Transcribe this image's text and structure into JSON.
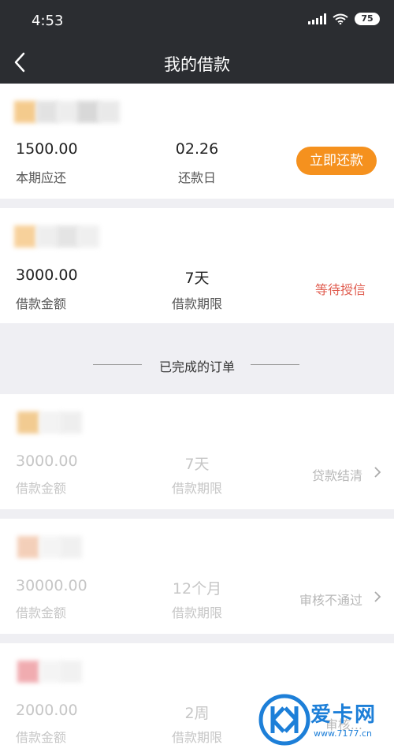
{
  "status_bar": {
    "time": "4:53",
    "battery": "75"
  },
  "nav": {
    "title": "我的借款"
  },
  "active_loans": [
    {
      "amount": "1500.00",
      "amount_label": "本期应还",
      "mid_value": "02.26",
      "mid_label": "还款日",
      "action": "立即还款"
    },
    {
      "amount": "3000.00",
      "amount_label": "借款金额",
      "mid_value": "7天",
      "mid_label": "借款期限",
      "status": "等待授信"
    }
  ],
  "completed_section_title": "已完成的订单",
  "completed_loans": [
    {
      "amount": "3000.00",
      "amount_label": "借款金额",
      "mid_value": "7天",
      "mid_label": "借款期限",
      "status": "贷款结清"
    },
    {
      "amount": "30000.00",
      "amount_label": "借款金额",
      "mid_value": "12个月",
      "mid_label": "借款期限",
      "status": "审核不通过"
    },
    {
      "amount": "2000.00",
      "amount_label": "借款金额",
      "mid_value": "2周",
      "mid_label": "借款期限",
      "status": "审核..."
    }
  ],
  "watermark": {
    "name": "爱卡网",
    "url": "www.7177.cn"
  },
  "colors": {
    "accent": "#f5911e",
    "pending": "#e05c4f",
    "header": "#2b2d31",
    "watermark": "#1d7fd8"
  }
}
